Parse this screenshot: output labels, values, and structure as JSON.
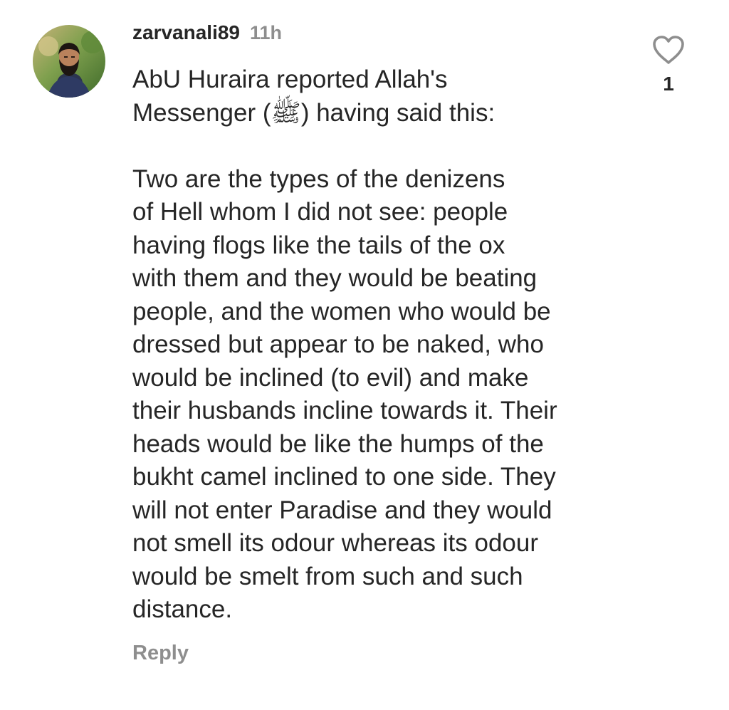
{
  "comment": {
    "username": "zarvanali89",
    "timestamp": "11h",
    "intro_lines": [
      "AbU Huraira reported Allah's",
      "Messenger (ﷺ) having said this:"
    ],
    "body_lines": [
      "Two are the types of the denizens",
      "of Hell whom I did not see: people",
      "having flogs like the tails of the ox",
      "with them and they would be beating",
      "people, and the women who would be",
      "dressed but appear to be naked, who",
      "would be inclined (to evil) and make",
      "their husbands incline towards it. Their",
      "heads would be like the humps of the",
      "bukht camel inclined to one side. They",
      "will not enter Paradise and they would",
      "not smell its odour whereas its odour",
      "would be smelt from such and such",
      "distance."
    ],
    "reply_label": "Reply",
    "like_count": "1"
  },
  "icons": {
    "like": "heart-outline-icon",
    "avatar": "user-avatar-photo"
  },
  "colors": {
    "primary_text": "#262626",
    "secondary_text": "#8e8e8e",
    "background": "#ffffff"
  }
}
